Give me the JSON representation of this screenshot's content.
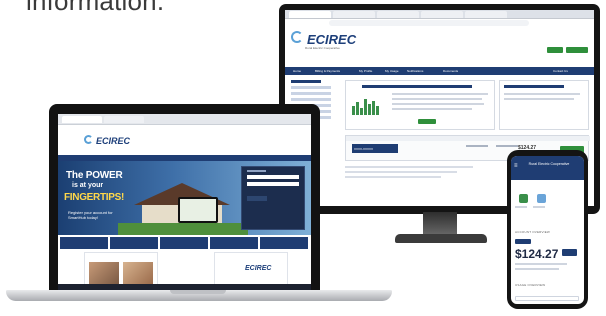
{
  "headline": "information.",
  "monitor": {
    "logo": "ECIREC",
    "tagline": "Rural Electric Cooperative",
    "nav_items": [
      "Home",
      "Billing & Payments",
      "My Profile",
      "My Usage",
      "Notifications",
      "Documents",
      "Contact Us"
    ],
    "account_id": "XXXX-XXXXX",
    "amount": "$124.27"
  },
  "laptop": {
    "logo": "ECIREC",
    "hero_line1": "The POWER",
    "hero_line2": "is at your",
    "hero_line3": "FINGERTIPS!",
    "hero_cta": "Register your account for SmartHub today!"
  },
  "phone": {
    "title": "Rural Electric Cooperative",
    "section_account": "ACCOUNT OVERVIEW",
    "amount": "$124.27",
    "section_usage": "USAGE OVERVIEW"
  },
  "colors": {
    "navy": "#1f3d73",
    "green": "#2f8f3b",
    "gold": "#ffd84a"
  }
}
